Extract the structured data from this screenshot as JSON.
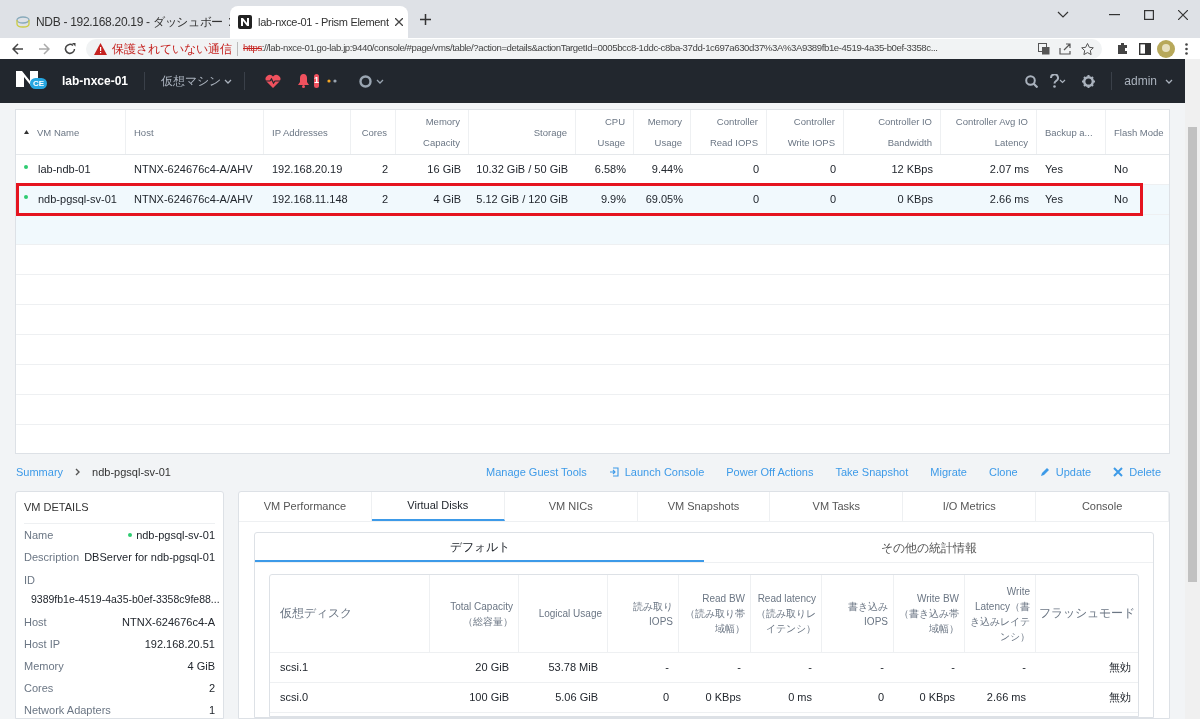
{
  "browser": {
    "tabs": [
      {
        "title": "NDB - 192.168.20.19 - ダッシュボー",
        "selected": false
      },
      {
        "title": "lab-nxce-01 - Prism Element",
        "selected": true
      }
    ],
    "security_warning": "保護されていない通信",
    "url_scheme": "https",
    "url_rest": "://lab-nxce-01.go-lab.jp:9440/console/#page/vms/table/?action=details&actionTargetId=0005bcc8-1ddc-c8ba-37dd-1c697a630d37%3A%3A9389fb1e-4519-4a35-b0ef-3358c..."
  },
  "app_header": {
    "logo_badge": "CE",
    "cluster": "lab-nxce-01",
    "view": "仮想マシン",
    "alert_count": "1",
    "user": "admin"
  },
  "vm_table": {
    "columns": [
      "VM Name",
      "Host",
      "IP Addresses",
      "Cores",
      "Memory Capacity",
      "Storage",
      "CPU Usage",
      "Memory Usage",
      "Controller Read IOPS",
      "Controller Write IOPS",
      "Controller IO Bandwidth",
      "Controller Avg IO Latency",
      "Backup a...",
      "Flash Mode"
    ],
    "rows": [
      {
        "selected": false,
        "highlighted": false,
        "color": "#2ecc71",
        "cells": [
          "lab-ndb-01",
          "NTNX-624676c4-A/AHV",
          "192.168.20.19",
          "2",
          "16 GiB",
          "10.32 GiB / 50 GiB",
          "6.58%",
          "9.44%",
          "0",
          "0",
          "12 KBps",
          "2.07 ms",
          "Yes",
          "No"
        ]
      },
      {
        "selected": true,
        "highlighted": true,
        "color": "#2ecc71",
        "cells": [
          "ndb-pgsql-sv-01",
          "NTNX-624676c4-A/AHV",
          "192.168.11.148",
          "2",
          "4 GiB",
          "5.12 GiB / 120 GiB",
          "9.9%",
          "69.05%",
          "0",
          "0",
          "0 KBps",
          "2.66 ms",
          "Yes",
          "No"
        ]
      }
    ]
  },
  "breadcrumb": [
    "Summary",
    "ndb-pgsql-sv-01"
  ],
  "actions": [
    {
      "label": "Manage Guest Tools",
      "kind": "plain"
    },
    {
      "label": "Launch Console",
      "kind": "console"
    },
    {
      "label": "Power Off Actions",
      "kind": "plain"
    },
    {
      "label": "Take Snapshot",
      "kind": "plain"
    },
    {
      "label": "Migrate",
      "kind": "plain"
    },
    {
      "label": "Clone",
      "kind": "plain"
    },
    {
      "label": "Update",
      "kind": "edit"
    },
    {
      "label": "Delete",
      "kind": "delete"
    }
  ],
  "vm_details": {
    "title": "VM DETAILS",
    "fields": [
      {
        "label": "Name",
        "value": "ndb-pgsql-sv-01",
        "color": "#2ecc71",
        "kind": "status"
      },
      {
        "label": "Description",
        "value": "DBServer for ndb-pgsql-01",
        "kind": "inline"
      },
      {
        "label": "ID",
        "value": "9389fb1e-4519-4a35-b0ef-3358c9fe88...",
        "kind": "stacked"
      },
      {
        "label": "Host",
        "value": "NTNX-624676c4-A",
        "kind": "inline"
      },
      {
        "label": "Host IP",
        "value": "192.168.20.51",
        "kind": "inline"
      },
      {
        "label": "Memory",
        "value": "4 GiB",
        "kind": "inline"
      },
      {
        "label": "Cores",
        "value": "2",
        "kind": "inline"
      },
      {
        "label": "Network Adapters",
        "value": "1",
        "kind": "inline"
      }
    ]
  },
  "detail_tabs": [
    {
      "label": "VM Performance",
      "selected": false
    },
    {
      "label": "Virtual Disks",
      "selected": true
    },
    {
      "label": "VM NICs",
      "selected": false
    },
    {
      "label": "VM Snapshots",
      "selected": false
    },
    {
      "label": "VM Tasks",
      "selected": false
    },
    {
      "label": "I/O Metrics",
      "selected": false
    },
    {
      "label": "Console",
      "selected": false
    }
  ],
  "sub_tabs": [
    {
      "label": "デフォルト",
      "selected": true
    },
    {
      "label": "その他の統計情報",
      "selected": false
    }
  ],
  "disk_table": {
    "columns": [
      "仮想ディスク",
      "Total Capacity（総容量）",
      "Logical Usage",
      "読み取りIOPS",
      "Read BW（読み取り帯域幅）",
      "Read latency（読み取りレイテンシ）",
      "書き込みIOPS",
      "Write BW（書き込み帯域幅）",
      "Write Latency（書き込みレイテンシ）",
      "フラッシュモード"
    ],
    "rows": [
      [
        "scsi.1",
        "20 GiB",
        "53.78 MiB",
        "-",
        "-",
        "-",
        "-",
        "-",
        "-",
        "無効"
      ],
      [
        "scsi.0",
        "100 GiB",
        "5.06 GiB",
        "0",
        "0 KBps",
        "0 ms",
        "0",
        "0 KBps",
        "2.66 ms",
        "無効"
      ]
    ]
  }
}
